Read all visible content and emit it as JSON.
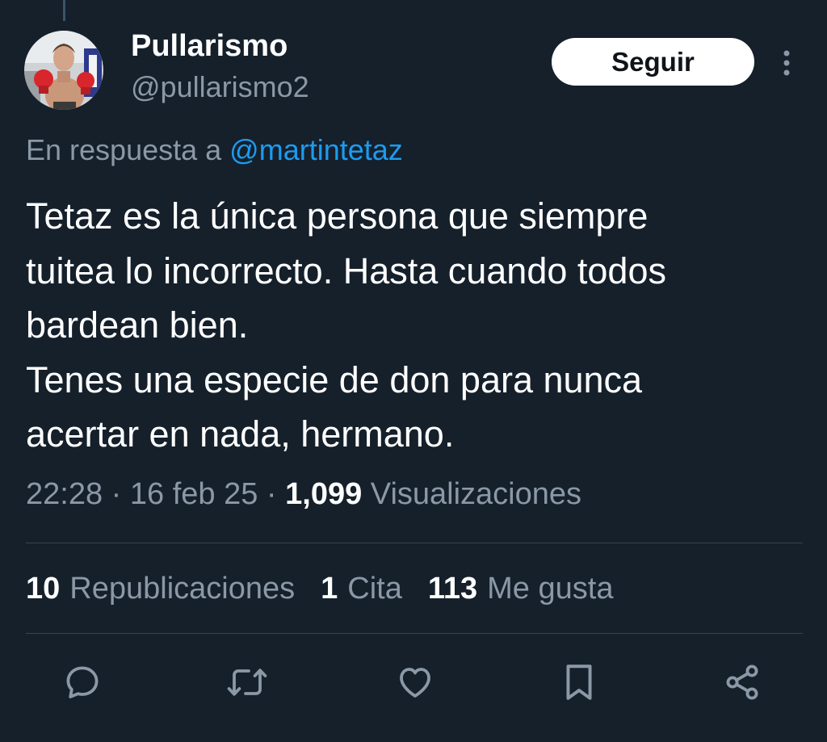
{
  "author": {
    "display_name": "Pullarismo",
    "handle": "@pullarismo2"
  },
  "header": {
    "follow_label": "Seguir"
  },
  "reply": {
    "prefix": "En respuesta a",
    "mention": "@martintetaz"
  },
  "tweet": {
    "text": "Tetaz es la única persona que siempre\ntuitea lo incorrecto. Hasta cuando todos\nbardean bien.\nTenes una especie de don para nunca\nacertar en nada, hermano.",
    "time": "22:28",
    "date": "16 feb 25",
    "views_count": "1,099",
    "views_label": "Visualizaciones"
  },
  "stats": {
    "reposts_count": "10",
    "reposts_label": "Republicaciones",
    "quotes_count": "1",
    "quotes_label": "Cita",
    "likes_count": "113",
    "likes_label": "Me gusta"
  },
  "icons": {
    "more": "more-vertical-icon",
    "reply": "reply-icon",
    "repost": "repost-icon",
    "like": "heart-icon",
    "bookmark": "bookmark-icon",
    "share": "share-icon"
  },
  "colors": {
    "background": "#15202b",
    "text": "#ffffff",
    "muted": "#8b98a5",
    "link": "#1d9bf0",
    "divider": "#38444d"
  }
}
